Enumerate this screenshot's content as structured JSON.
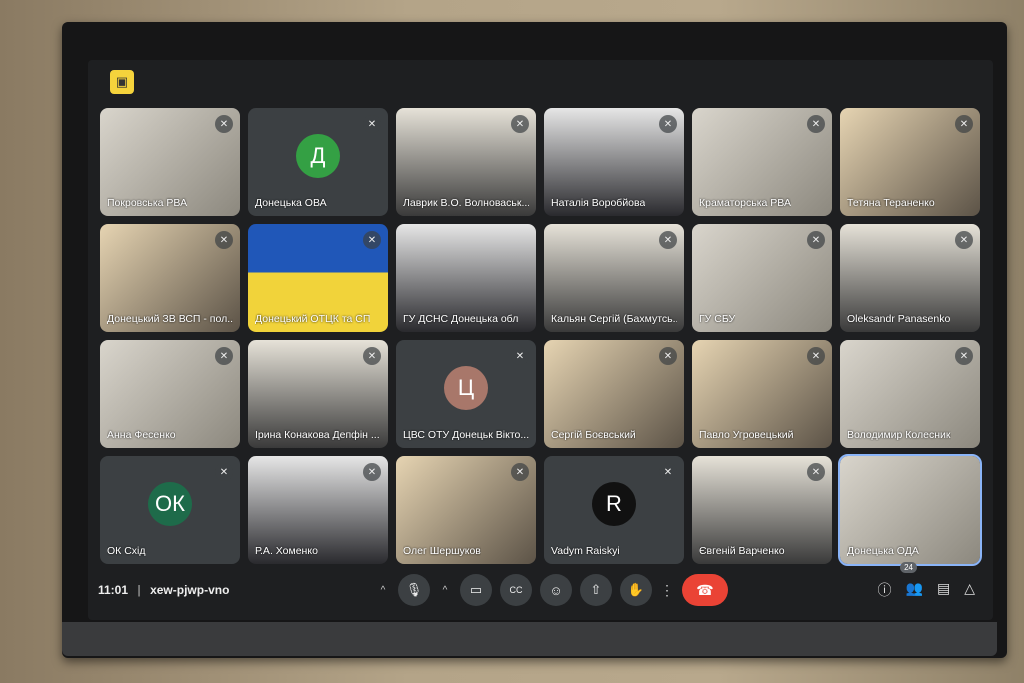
{
  "meeting": {
    "time": "11:01",
    "separator": "|",
    "code": "xew-pjwp-vno",
    "participant_count": "24"
  },
  "colors": {
    "background": "#1e1f21",
    "tile": "#3c4043",
    "end_call": "#ea4335",
    "active_outline": "#8ab4f8"
  },
  "tiles": [
    {
      "name": "Покровська РВА",
      "type": "video",
      "muted": true
    },
    {
      "name": "Донецька ОВА",
      "type": "avatar",
      "initial": "Д",
      "color": "#34a044",
      "muted": true
    },
    {
      "name": "Лаврик В.О. Волноваськ...",
      "type": "video",
      "muted": true
    },
    {
      "name": "Наталія Воробйова",
      "type": "video",
      "muted": true
    },
    {
      "name": "Краматорська РВА",
      "type": "video",
      "muted": true
    },
    {
      "name": "Тетяна Тераненко",
      "type": "video",
      "muted": true
    },
    {
      "name": "Донецький ЗВ ВСП - пол...",
      "type": "video",
      "muted": true
    },
    {
      "name": "Донецький ОТЦК та СП",
      "type": "video",
      "muted": true
    },
    {
      "name": "ГУ ДСНС Донецька обл",
      "type": "video",
      "muted": false
    },
    {
      "name": "Кальян Сергій (Бахмутсь...",
      "type": "video",
      "muted": true
    },
    {
      "name": "ГУ СБУ",
      "type": "video",
      "muted": true
    },
    {
      "name": "Oleksandr Panasenko",
      "type": "video",
      "muted": true
    },
    {
      "name": "Анна Фесенко",
      "type": "video",
      "muted": true
    },
    {
      "name": "Ірина Конакова Депфін ...",
      "type": "video",
      "muted": true
    },
    {
      "name": "ЦВС ОТУ Донецьк Вікто...",
      "type": "avatar",
      "initial": "Ц",
      "color": "#a8776a",
      "muted": true
    },
    {
      "name": "Сергій Боєвський",
      "type": "video",
      "muted": true
    },
    {
      "name": "Павло Угровецький",
      "type": "video",
      "muted": true
    },
    {
      "name": "Володимир Колесник",
      "type": "video",
      "muted": true
    },
    {
      "name": "ОК Схід",
      "type": "avatar",
      "initial": "ОК",
      "color": "#1e6b4a",
      "muted": true
    },
    {
      "name": "Р.А. Хоменко",
      "type": "video",
      "muted": true
    },
    {
      "name": "Олег Шершуков",
      "type": "video",
      "muted": true
    },
    {
      "name": "Vadym Raiskyi",
      "type": "avatar",
      "initial": "R",
      "color": "#111111",
      "muted": true
    },
    {
      "name": "Євгеній Варченко",
      "type": "video",
      "muted": true
    },
    {
      "name": "Донецька ОДА",
      "type": "video",
      "muted": false,
      "active": true
    }
  ],
  "controls": [
    "mic-icon",
    "camera-icon",
    "captions-icon",
    "emoji-icon",
    "present-icon",
    "raise-hand-icon",
    "more-icon",
    "end-call-icon"
  ],
  "right_controls": [
    "info-icon",
    "people-icon",
    "chat-icon",
    "activities-icon"
  ]
}
